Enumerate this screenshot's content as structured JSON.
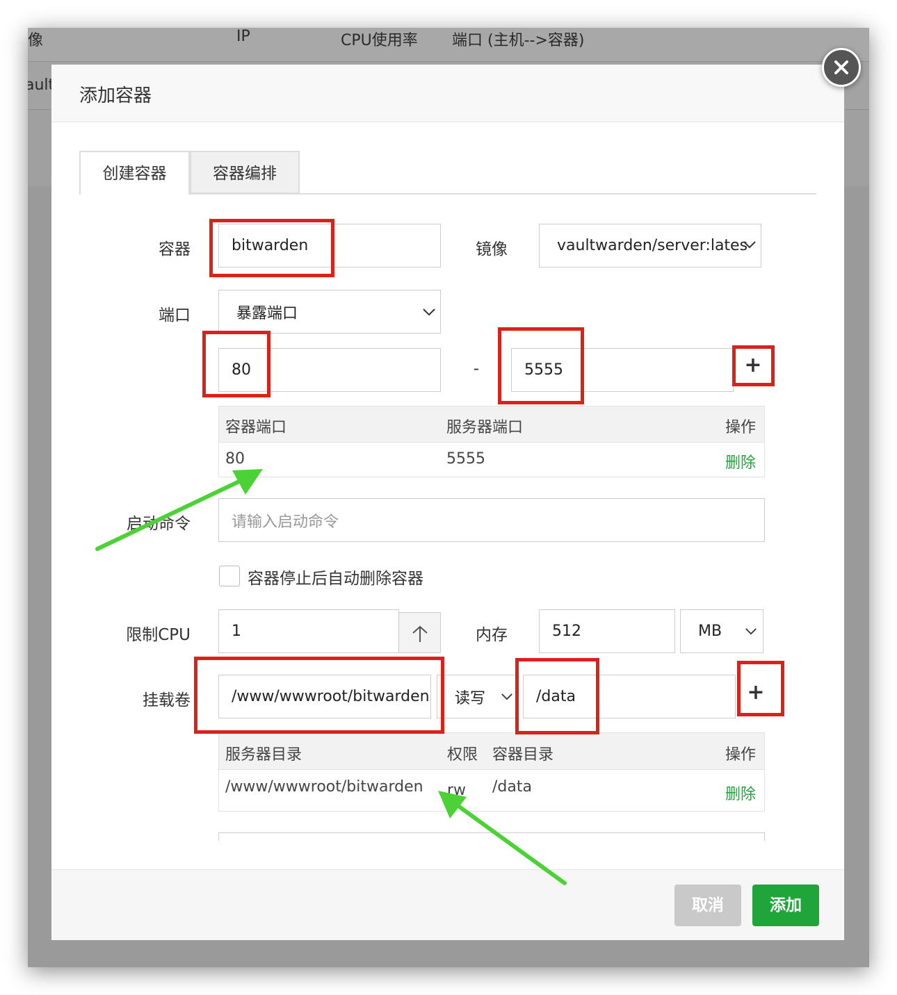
{
  "background": {
    "columns": [
      "像",
      "IP",
      "CPU使用率",
      "端口 (主机-->容器)"
    ],
    "row_fragment": "ault"
  },
  "dialog": {
    "title": "添加容器",
    "tabs": [
      "创建容器",
      "容器编排"
    ],
    "labels": {
      "container": "容器",
      "image": "镜像",
      "port": "端口",
      "command": "启动命令",
      "limit_cpu": "限制CPU",
      "memory": "内存",
      "volume": "挂载卷"
    },
    "container_name": "bitwarden",
    "image_value": "vaultwarden/server:lates",
    "port_mode": "暴露端口",
    "port_container": "80",
    "port_separator": "-",
    "port_server": "5555",
    "port_table": {
      "headers": [
        "容器端口",
        "服务器端口",
        "操作"
      ],
      "rows": [
        {
          "container": "80",
          "server": "5555",
          "action": "删除"
        }
      ]
    },
    "command_placeholder": "请输入启动命令",
    "auto_remove_label": "容器停止后自动删除容器",
    "cpu_value": "1",
    "memory_value": "512",
    "memory_unit": "MB",
    "volume_host": "/www/wwwroot/bitwarden",
    "volume_mode": "读写",
    "volume_container": "/data",
    "volume_table": {
      "headers": [
        "服务器目录",
        "权限",
        "容器目录",
        "操作"
      ],
      "rows": [
        {
          "host": "/www/wwwroot/bitwarden",
          "perm": "rw",
          "container": "/data",
          "action": "删除"
        }
      ]
    },
    "add_symbol": "+",
    "buttons": {
      "cancel": "取消",
      "add": "添加"
    }
  },
  "colors": {
    "annotation_red": "#d9221b",
    "annotation_green": "#4cd137",
    "success_green": "#20a53a",
    "disabled_gray": "#c9c9c9"
  }
}
